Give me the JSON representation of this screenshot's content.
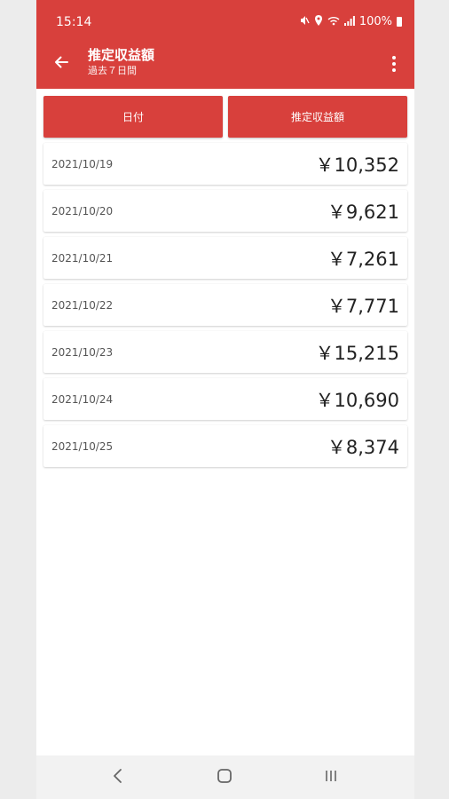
{
  "status_bar": {
    "time": "15:14",
    "battery": "100%",
    "icons": [
      "mute-icon",
      "location-icon",
      "wifi-icon",
      "signal-icon",
      "battery-icon"
    ]
  },
  "app_bar": {
    "title": "推定収益額",
    "subtitle": "過去７日間",
    "icons": [
      "back-arrow-icon",
      "more-vert-icon"
    ]
  },
  "table": {
    "headers": [
      "日付",
      "推定収益額"
    ],
    "rows": [
      {
        "date": "2021/10/19",
        "amount": "￥10,352"
      },
      {
        "date": "2021/10/20",
        "amount": "￥9,621"
      },
      {
        "date": "2021/10/21",
        "amount": "￥7,261"
      },
      {
        "date": "2021/10/22",
        "amount": "￥7,771"
      },
      {
        "date": "2021/10/23",
        "amount": "￥15,215"
      },
      {
        "date": "2021/10/24",
        "amount": "￥10,690"
      },
      {
        "date": "2021/10/25",
        "amount": "￥8,374"
      }
    ]
  },
  "nav_bar": {
    "icons": [
      "back-nav-icon",
      "home-nav-icon",
      "recents-nav-icon"
    ]
  },
  "colors": {
    "accent": "#d8403c",
    "background": "#ffffff",
    "side": "#ececec"
  }
}
